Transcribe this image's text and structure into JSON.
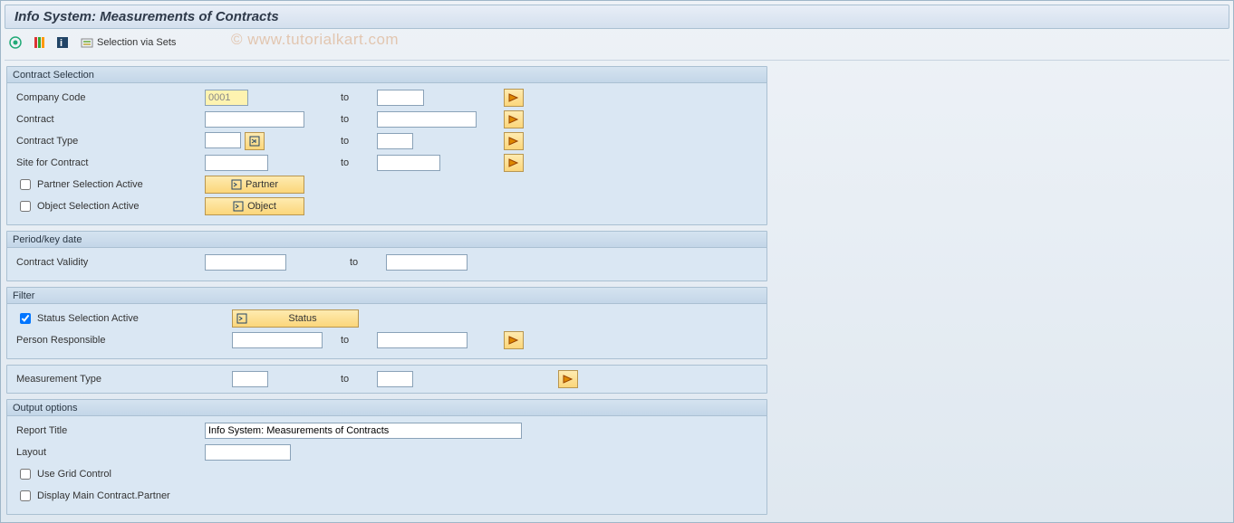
{
  "title": "Info System: Measurements of Contracts",
  "toolbar": {
    "selection_via_sets": "Selection via Sets"
  },
  "watermark": "© www.tutorialkart.com",
  "group_contract": {
    "header": "Contract Selection",
    "company_code_label": "Company Code",
    "company_code_value": "0001",
    "contract_label": "Contract",
    "contract_type_label": "Contract Type",
    "site_label": "Site for Contract",
    "partner_sel_label": "Partner Selection Active",
    "object_sel_label": "Object Selection Active",
    "partner_btn": "Partner",
    "object_btn": "Object",
    "to": "to"
  },
  "group_period": {
    "header": "Period/key date",
    "validity_label": "Contract Validity",
    "to": "to"
  },
  "group_filter": {
    "header": "Filter",
    "status_sel_label": "Status Selection Active",
    "status_btn": "Status",
    "person_label": "Person Responsible",
    "to": "to"
  },
  "row_measurement": {
    "label": "Measurement Type",
    "to": "to"
  },
  "group_output": {
    "header": "Output options",
    "report_title_label": "Report Title",
    "report_title_value": "Info System: Measurements of Contracts",
    "layout_label": "Layout",
    "grid_label": "Use Grid Control",
    "main_partner_label": "Display Main Contract.Partner"
  }
}
